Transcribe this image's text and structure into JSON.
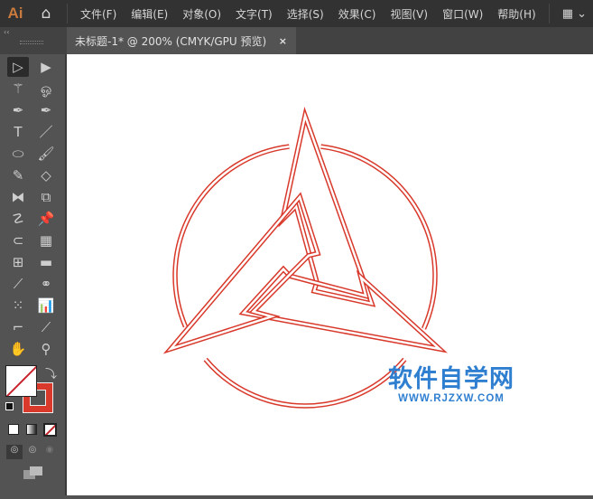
{
  "app": {
    "logo": "Ai",
    "home_icon": "home-icon"
  },
  "menu": [
    "文件(F)",
    "编辑(E)",
    "对象(O)",
    "文字(T)",
    "选择(S)",
    "效果(C)",
    "视图(V)",
    "窗口(W)",
    "帮助(H)"
  ],
  "workspace_icon": "workspace-switcher-icon",
  "document_tab": {
    "title": "未标题-1* @ 200% (CMYK/GPU 预览)",
    "close": "×"
  },
  "panel_collapse": "‹‹",
  "tools": [
    {
      "name": "selection-tool",
      "glyph": "▷",
      "selected": true
    },
    {
      "name": "direct-selection-tool",
      "glyph": "▶"
    },
    {
      "name": "magic-wand-tool",
      "glyph": "⚚"
    },
    {
      "name": "lasso-tool",
      "glyph": "ஓ"
    },
    {
      "name": "pen-tool",
      "glyph": "✒"
    },
    {
      "name": "curvature-tool",
      "glyph": "✒"
    },
    {
      "name": "type-tool",
      "glyph": "T"
    },
    {
      "name": "line-segment-tool",
      "glyph": "／"
    },
    {
      "name": "ellipse-tool",
      "glyph": "⬭"
    },
    {
      "name": "paintbrush-tool",
      "glyph": "🖌"
    },
    {
      "name": "pencil-tool",
      "glyph": "✎"
    },
    {
      "name": "eraser-tool",
      "glyph": "◇"
    },
    {
      "name": "reflect-tool",
      "glyph": "⧓"
    },
    {
      "name": "scale-tool",
      "glyph": "⧉"
    },
    {
      "name": "puppet-warp-tool",
      "glyph": "☡"
    },
    {
      "name": "pin-tool",
      "glyph": "📌"
    },
    {
      "name": "shape-builder-tool",
      "glyph": "⊂"
    },
    {
      "name": "perspective-grid-tool",
      "glyph": "▦"
    },
    {
      "name": "mesh-tool",
      "glyph": "⊞"
    },
    {
      "name": "gradient-tool",
      "glyph": "▬"
    },
    {
      "name": "eyedropper-tool",
      "glyph": "⟋"
    },
    {
      "name": "blend-tool",
      "glyph": "⚭"
    },
    {
      "name": "symbol-sprayer-tool",
      "glyph": "⁙"
    },
    {
      "name": "column-graph-tool",
      "glyph": "📊"
    },
    {
      "name": "artboard-tool",
      "glyph": "⌐"
    },
    {
      "name": "slice-tool",
      "glyph": "⟋"
    },
    {
      "name": "hand-tool",
      "glyph": "✋"
    },
    {
      "name": "zoom-tool",
      "glyph": "⚲"
    }
  ],
  "colors": {
    "stroke": "#d8392b",
    "fill": "none",
    "accent": "#2f7fd1"
  },
  "swap_icon": "⤵",
  "watermark": {
    "cn": "软件自学网",
    "en": "WWW.RJZXW.COM"
  }
}
